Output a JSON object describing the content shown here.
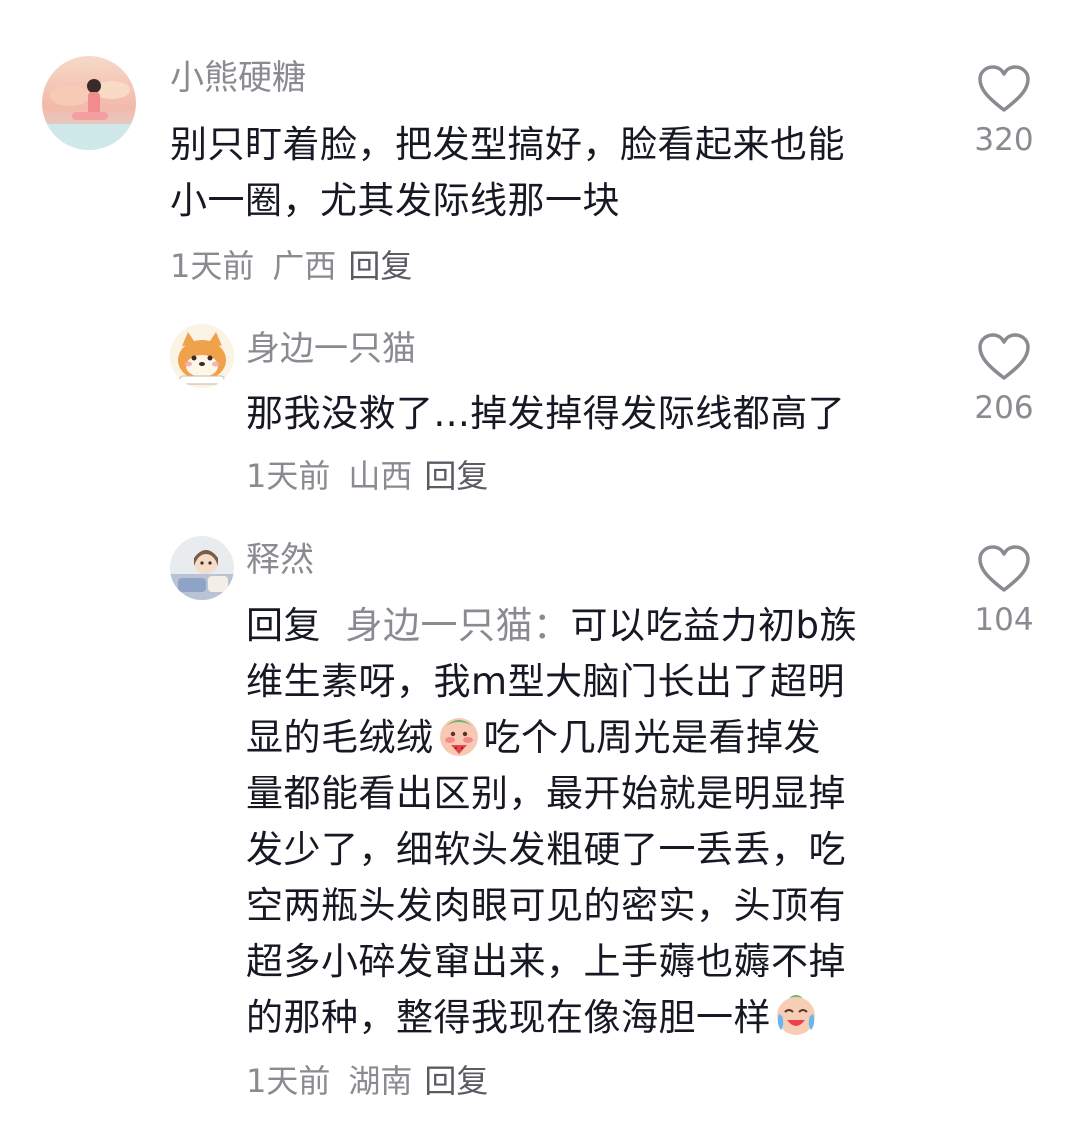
{
  "comments": [
    {
      "username": "小熊硬糖",
      "lines": [
        "别只盯着脸，把发型搞好，脸看起来也能",
        "小一圈，尤其发际线那一块"
      ],
      "time": "1天前",
      "location": "广西",
      "reply_label": "回复",
      "likes": "320"
    },
    {
      "username": "身边一只猫",
      "lines": [
        "那我没救了...掉发掉得发际线都高了"
      ],
      "time": "1天前",
      "location": "山西",
      "reply_label": "回复",
      "likes": "206"
    },
    {
      "username": "释然",
      "reply_prefix": "回复",
      "reply_to": "身边一只猫：",
      "line1_rest": "可以吃益力初b族",
      "line2": "维生素呀，我m型大脑门长出了超明",
      "line3_before_emoji": "显的毛绒绒",
      "line3_after_emoji": "吃个几周光是看掉发",
      "line4": "量都能看出区别，最开始就是明显掉",
      "line5": "发少了，细软头发粗硬了一丢丢，吃",
      "line6": "空两瓶头发肉眼可见的密实，头顶有",
      "line7": "超多小碎发窜出来，上手薅也薅不掉",
      "line8_before_emoji": "的那种，整得我现在像海胆一样",
      "emoji1": "watermelon-blush-emoji",
      "emoji2": "crying-laugh-emoji",
      "time": "1天前",
      "location": "湖南",
      "reply_label": "回复",
      "likes": "104"
    }
  ],
  "icons": {
    "like": "heart-outline-icon"
  },
  "colors": {
    "text": "#161823",
    "secondary": "#8a8b91"
  }
}
